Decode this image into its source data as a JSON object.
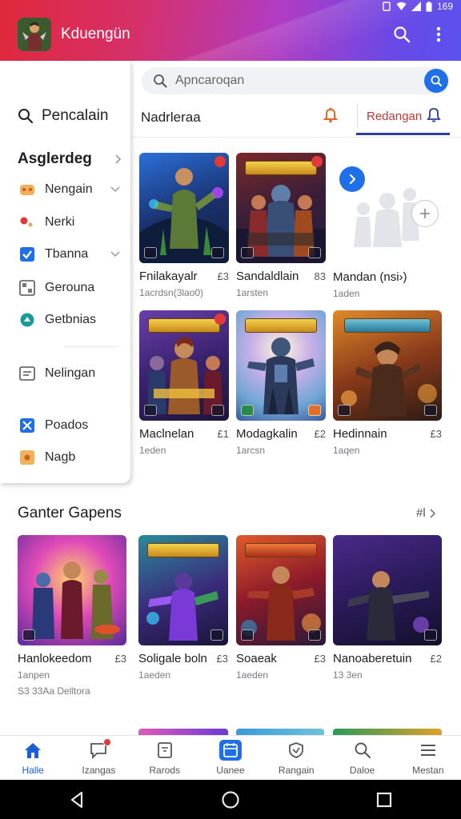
{
  "status_bar": {
    "time": "169"
  },
  "app": {
    "title": "Kduengün"
  },
  "drawer": {
    "search_label": "Pencalain",
    "section_label": "Asglerdeg",
    "items": [
      {
        "label": "Nengain",
        "icon": "controller-icon"
      },
      {
        "label": "Nerki",
        "icon": "red-dots-icon"
      },
      {
        "label": "Tbanna",
        "icon": "checkbox-icon"
      },
      {
        "label": "Gerouna",
        "icon": "grid-icon"
      },
      {
        "label": "Getbnias",
        "icon": "teal-circle-icon"
      },
      {
        "label": "Nelingan",
        "icon": "list-box-icon"
      },
      {
        "label": "Poados",
        "icon": "crossed-swords-icon"
      },
      {
        "label": "Nagb",
        "icon": "orange-tile-icon"
      }
    ]
  },
  "search": {
    "placeholder": "Apncaroqan"
  },
  "filter": {
    "label": "Nadrleraa",
    "tab": "Redangan"
  },
  "top_cards": [
    {
      "title": "Fnilakayalr",
      "rank": "£3",
      "sub": "1acrdsn(3lao0)"
    },
    {
      "title": "Sandaldlain",
      "rank": "83",
      "sub": "1arsten"
    },
    {
      "title": "Mandan (nsi›)",
      "rank": "",
      "sub": "1aden"
    },
    {
      "title": "Maclnelan",
      "rank": "£1",
      "sub": "1eden"
    },
    {
      "title": "Modagkalin",
      "rank": "£2",
      "sub": "1arcsn"
    },
    {
      "title": "Hedinnain",
      "rank": "£3",
      "sub": "1aqen"
    }
  ],
  "section": {
    "title": "Ganter Gapens",
    "more": "#l",
    "cards": [
      {
        "title": "Hanlokeedom",
        "rank": "£3",
        "sub": "1anpen",
        "extra": "S3 33Aa Delltora"
      },
      {
        "title": "Soligale boln",
        "rank": "£3",
        "sub": "1aeden",
        "extra": ""
      },
      {
        "title": "Soaeak",
        "rank": "£3",
        "sub": "1aeden",
        "extra": ""
      },
      {
        "title": "Nanoaberetuin",
        "rank": "£2",
        "sub": "13 3en",
        "extra": ""
      }
    ],
    "banner_texts": [
      "MIAIIBAM",
      "NEHERHS",
      "QMIXOGOS"
    ],
    "top_banner_texts": [
      "MUDAVAN",
      "",
      "",
      "NIRHARAN",
      "MARKAN",
      "LIBRIRAN"
    ]
  },
  "bottom_nav": [
    {
      "label": "Halle",
      "icon": "home-icon",
      "active": true
    },
    {
      "label": "Izangas",
      "icon": "chat-icon",
      "active": false
    },
    {
      "label": "Rarods",
      "icon": "tablet-icon",
      "active": false
    },
    {
      "label": "Uanee",
      "icon": "calendar-icon",
      "active": false
    },
    {
      "label": "Rangain",
      "icon": "shield-icon",
      "active": false
    },
    {
      "label": "Daloe",
      "icon": "search-icon",
      "active": false
    },
    {
      "label": "Mestan",
      "icon": "menu-icon",
      "active": false
    }
  ],
  "colors": {
    "accent": "#1e6fe8",
    "appbar_start": "#e0283b",
    "appbar_end": "#5a52ee",
    "active_nav": "#1a5fd8",
    "filter_tab": "#c23838"
  }
}
